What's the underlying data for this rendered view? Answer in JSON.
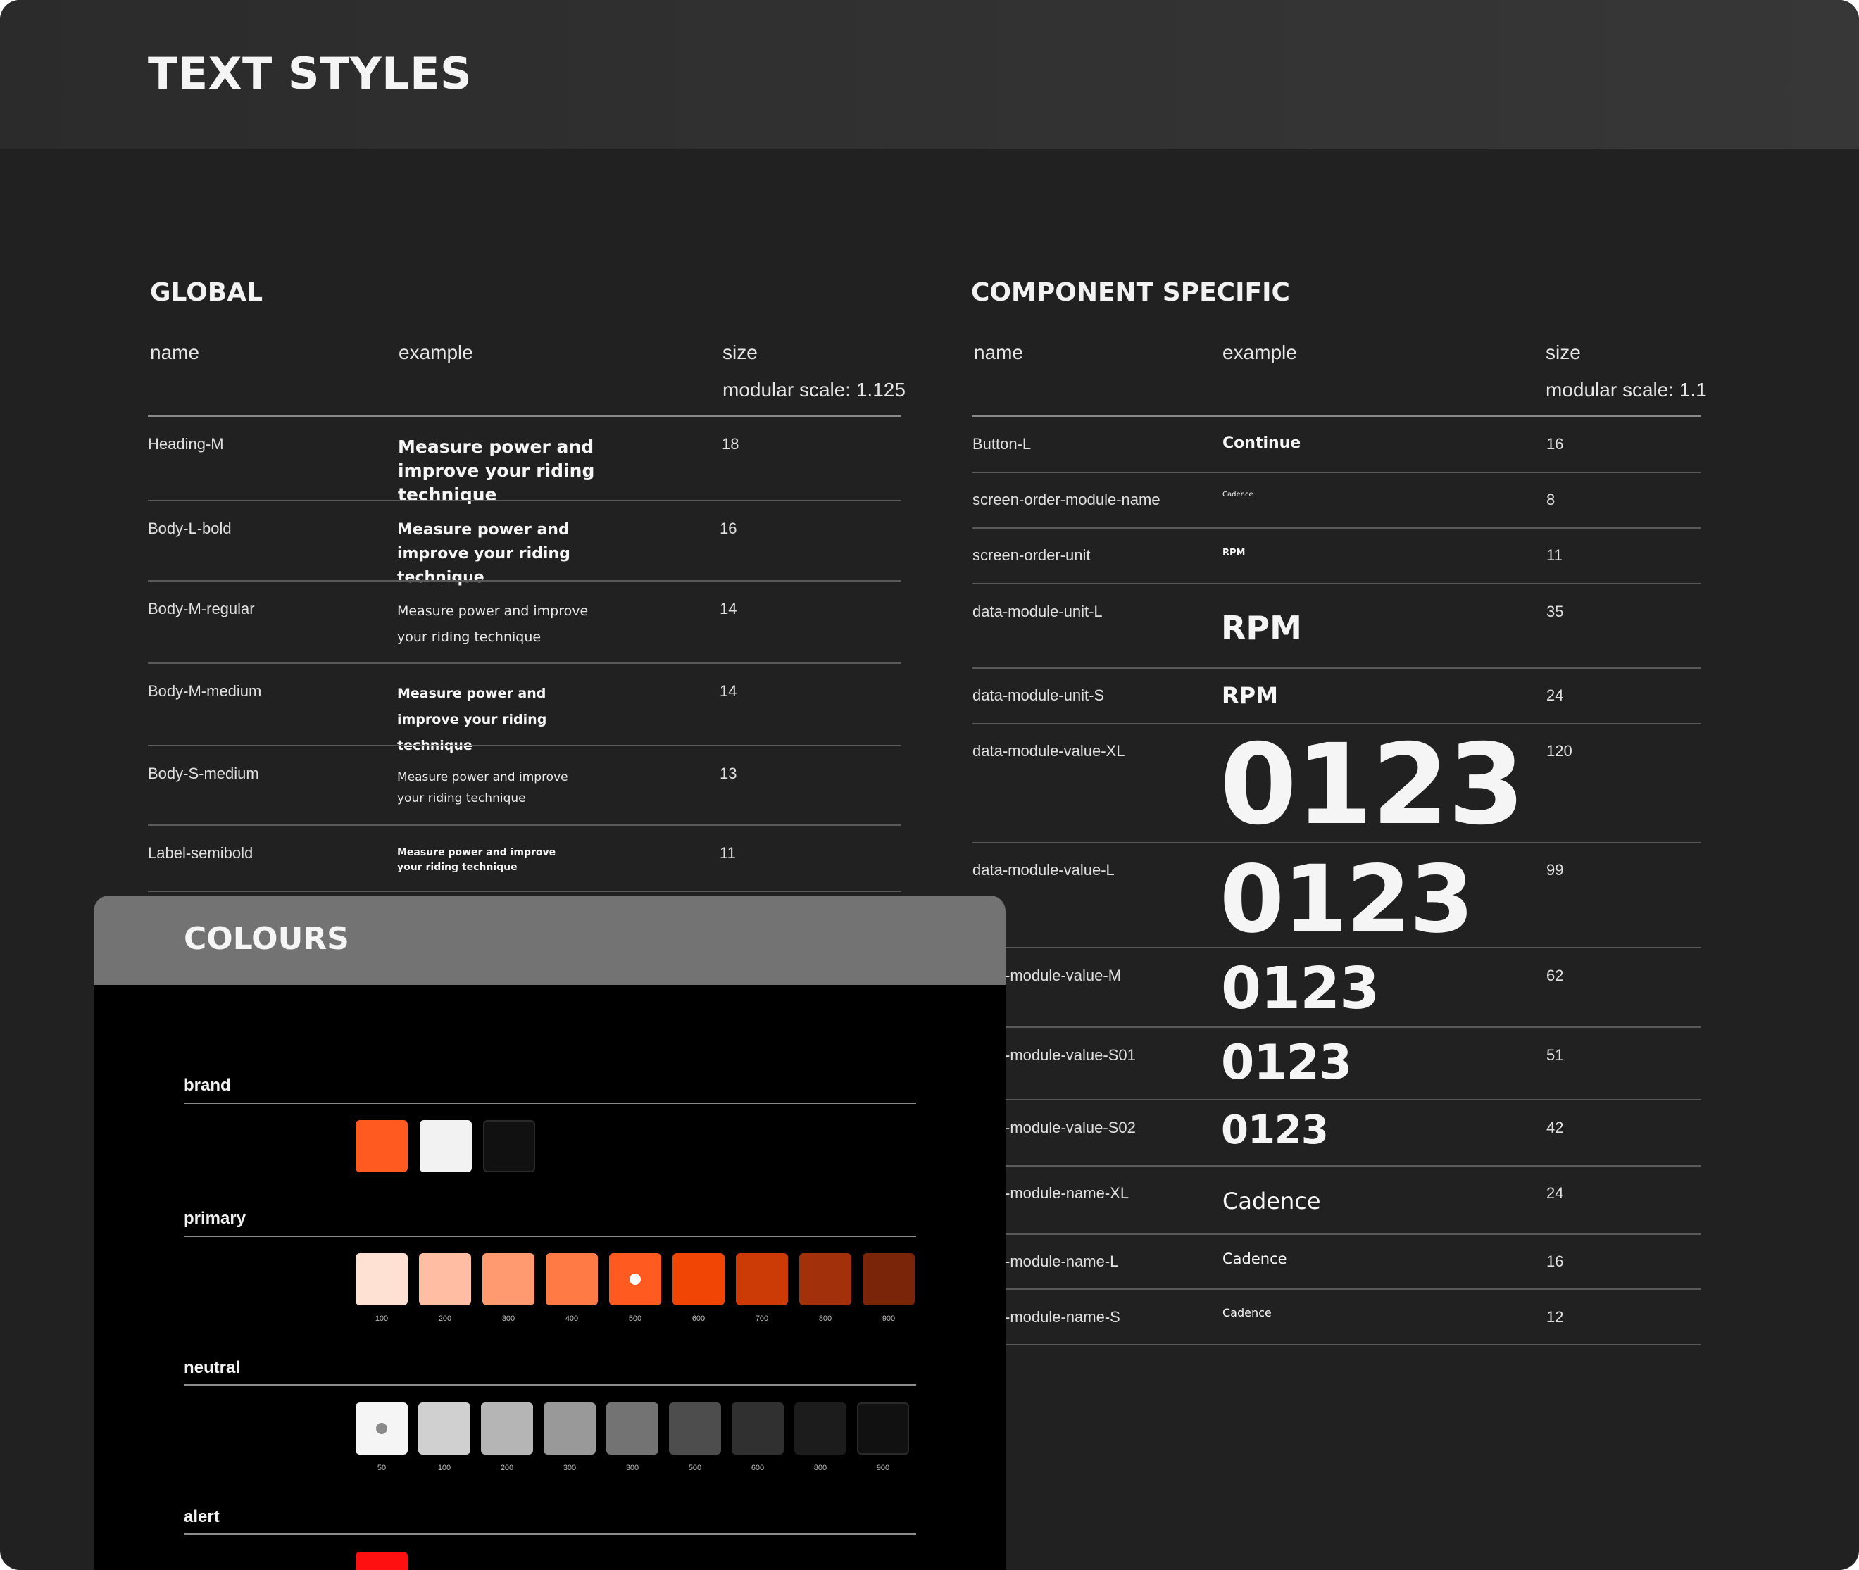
{
  "title": "TEXT STYLES",
  "global": {
    "title": "GLOBAL",
    "headers": {
      "name": "name",
      "example": "example",
      "size": "size",
      "scale": "modular scale: 1.125"
    },
    "rows": [
      {
        "name": "Heading-M",
        "example": "Measure power and improve your riding technique",
        "size": "18"
      },
      {
        "name": "Body-L-bold",
        "example": "Measure power and improve your riding technique",
        "size": "16"
      },
      {
        "name": "Body-M-regular",
        "example": "Measure power and improve your riding technique",
        "size": "14"
      },
      {
        "name": "Body-M-medium",
        "example": "Measure power and improve your riding technique",
        "size": "14"
      },
      {
        "name": "Body-S-medium",
        "example": "Measure power and improve your riding technique",
        "size": "13"
      },
      {
        "name": "Label-semibold",
        "example": "Measure power and improve your riding technique",
        "size": "11"
      }
    ]
  },
  "component": {
    "title": "COMPONENT SPECIFIC",
    "headers": {
      "name": "name",
      "example": "example",
      "size": "size",
      "scale": "modular scale: 1.1"
    },
    "rows": [
      {
        "name": "Button-L",
        "example": "Continue",
        "size": "16"
      },
      {
        "name": "screen-order-module-name",
        "example": "Cadence",
        "size": "8"
      },
      {
        "name": "screen-order-unit",
        "example": "RPM",
        "size": "11"
      },
      {
        "name": "data-module-unit-L",
        "example": "RPM",
        "size": "35"
      },
      {
        "name": "data-module-unit-S",
        "example": "RPM",
        "size": "24"
      },
      {
        "name": "data-module-value-XL",
        "example": "0123",
        "size": "120"
      },
      {
        "name": "data-module-value-L",
        "example": "0123",
        "size": "99"
      },
      {
        "name": "-module-value-M",
        "example": "0123",
        "size": "62"
      },
      {
        "name": "-module-value-S01",
        "example": "0123",
        "size": "51"
      },
      {
        "name": "-module-value-S02",
        "example": "0123",
        "size": "42"
      },
      {
        "name": "-module-name-XL",
        "example": "Cadence",
        "size": "24"
      },
      {
        "name": "-module-name-L",
        "example": "Cadence",
        "size": "16"
      },
      {
        "name": "-module-name-S",
        "example": "Cadence",
        "size": "12"
      }
    ]
  },
  "colours": {
    "title": "COLOURS",
    "groups": {
      "brand": {
        "label": "brand",
        "swatches": [
          "#ff5a1f",
          "#f2f2f2",
          "#111111"
        ]
      },
      "primary": {
        "label": "primary",
        "swatches": [
          {
            "label": "100",
            "color": "#ffe1d4"
          },
          {
            "label": "200",
            "color": "#ffbea3"
          },
          {
            "label": "300",
            "color": "#ff9a70"
          },
          {
            "label": "400",
            "color": "#ff7a45"
          },
          {
            "label": "500",
            "color": "#ff5a1f"
          },
          {
            "label": "600",
            "color": "#f04505"
          },
          {
            "label": "700",
            "color": "#cc3b05"
          },
          {
            "label": "800",
            "color": "#a2300a"
          },
          {
            "label": "900",
            "color": "#7a2409"
          }
        ]
      },
      "neutral": {
        "label": "neutral",
        "swatches": [
          {
            "label": "50",
            "color": "#f5f5f5"
          },
          {
            "label": "100",
            "color": "#d0d0d0"
          },
          {
            "label": "200",
            "color": "#b5b5b5"
          },
          {
            "label": "300",
            "color": "#999999"
          },
          {
            "label": "300",
            "color": "#737373"
          },
          {
            "label": "500",
            "color": "#4d4d4d"
          },
          {
            "label": "600",
            "color": "#303030"
          },
          {
            "label": "800",
            "color": "#1c1c1c"
          },
          {
            "label": "900",
            "color": "#111111"
          }
        ]
      },
      "alert": {
        "label": "alert",
        "swatches": [
          "#ff1010"
        ]
      }
    }
  }
}
